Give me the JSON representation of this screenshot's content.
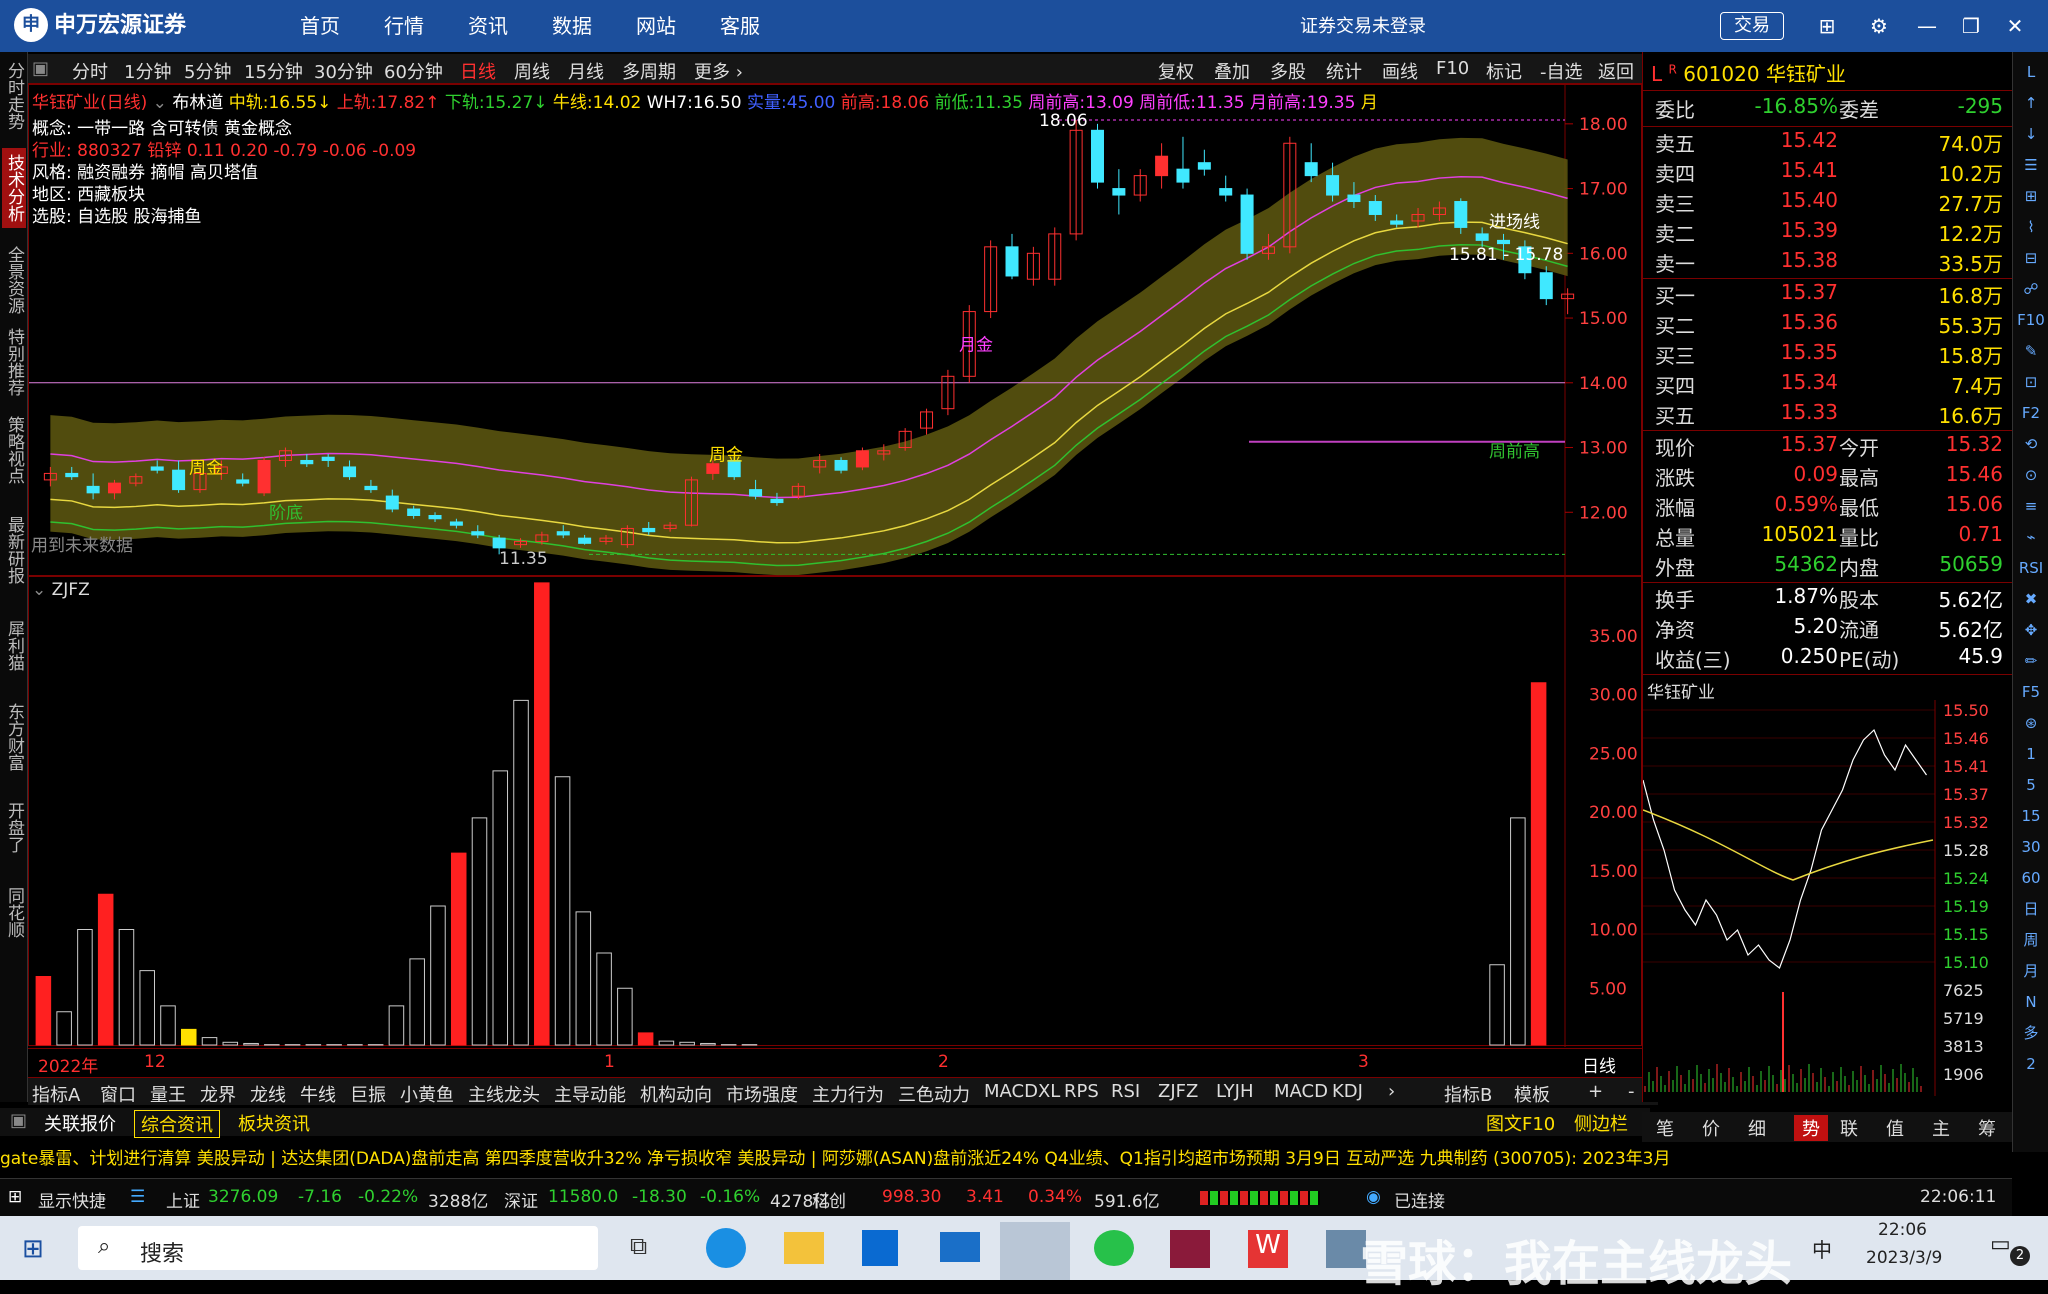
{
  "app": {
    "logo_text": "申万宏源证券",
    "nav": [
      "首页",
      "行情",
      "资讯",
      "数据",
      "网站",
      "客服"
    ],
    "status": "证券交易未登录",
    "trade_button": "交易"
  },
  "left_tabs": [
    "分时走势",
    "技术分析",
    "全景资源",
    "特别推荐",
    "策略视点",
    "最新研报",
    "犀利猫",
    "东方财富",
    "开盘了",
    "同花顺"
  ],
  "right_icons": [
    "L",
    "↑",
    "↓",
    "☰",
    "⊞",
    "⌇",
    "⊟",
    "☍",
    "F10",
    "✎",
    "⊡",
    "F2",
    "⟲",
    "⊙",
    "≡",
    "⌁",
    "RSI",
    "✖",
    "✥",
    "✏",
    "F5",
    "⊛",
    "1",
    "5",
    "15",
    "30",
    "60",
    "日",
    "周",
    "月",
    "N",
    "多",
    "2"
  ],
  "toolbar": {
    "periods": [
      "分时",
      "1分钟",
      "5分钟",
      "15分钟",
      "30分钟",
      "60分钟",
      "日线",
      "周线",
      "月线",
      "多周期",
      "更多"
    ],
    "active_period": "日线",
    "right": [
      "复权",
      "叠加",
      "多股",
      "统计",
      "画线",
      "F10",
      "标记",
      "-自选",
      "返回"
    ]
  },
  "chart_info": {
    "name": "华钰矿业(日线)",
    "indicator": "布林道",
    "mid_label": "中轨:",
    "mid": "16.55",
    "up_label": "上轨:",
    "up": "17.82",
    "down_label": "下轨:",
    "down": "15.27",
    "bull_label": "牛线:",
    "bull": "14.02",
    "wh7_label": "WH7:",
    "wh7": "16.50",
    "vol_label": "实量:",
    "vol": "45.00",
    "prev_high_label": "前高:",
    "prev_high": "18.06",
    "prev_low_label": "前低:",
    "prev_low": "11.35",
    "week_high_label": "周前高:",
    "week_high": "13.09",
    "week_low_label": "周前低:",
    "week_low": "11.35",
    "month_high_label": "月前高:",
    "month_high": "19.35",
    "month_suffix": "月"
  },
  "concepts": {
    "line1": "概念: 一带一路 含可转债 黄金概念",
    "line2": "行业: 880327 铅锌 0.11 0.20 -0.79 -0.06 -0.09",
    "line3": "风格: 融资融券 摘帽 高贝塔值",
    "line4": "地区: 西藏板块",
    "line5": "选股: 自选股 股海捕鱼"
  },
  "annotations": {
    "peak": "18.06",
    "yuejin": "月金",
    "jinchang": "进场线",
    "range": "15.81 - 15.78",
    "zhouqianguo": "周前高",
    "zhoujin1": "周金",
    "zhoujin2": "周金",
    "jiedi": "阶底",
    "low": "11.35",
    "future": "用到未来数据"
  },
  "price_axis": [
    "18.00",
    "17.00",
    "16.00",
    "15.00",
    "14.00",
    "13.00",
    "12.00"
  ],
  "sub_indicator": "ZJFZ",
  "sub_axis": [
    "35.00",
    "30.00",
    "25.00",
    "20.00",
    "15.00",
    "10.00",
    "5.00"
  ],
  "x_labels": {
    "year": "2022年",
    "m12": "12",
    "m1": "1",
    "m2": "2",
    "m3": "3"
  },
  "period_label": "日线",
  "indicator_tabs": [
    "指标A",
    "窗口",
    "量王",
    "龙界",
    "龙线",
    "牛线",
    "巨振",
    "小黄鱼",
    "主线龙头",
    "主导动能",
    "机构动向",
    "市场强度",
    "主力行为",
    "三色动力",
    "MACDXL",
    "RPS",
    "RSI",
    "ZJFZ",
    "LYJH",
    "MACD",
    "KDJ"
  ],
  "indicator_tabs_right": [
    "指标B",
    "模板",
    "+",
    "-"
  ],
  "bottom_tabs": [
    "关联报价",
    "综合资讯",
    "板块资讯"
  ],
  "bottom_right": [
    "图文F10",
    "侧边栏"
  ],
  "ticker": "gate暴雷、计划进行清算    美股异动 | 达达集团(DADA)盘前走高 第四季度营收升32% 净亏损收窄    美股异动 | 阿莎娜(ASAN)盘前涨近24% Q4业绩、Q1指引均超市场预期    3月9日 互动严选    九典制药 (300705): 2023年3月",
  "indexbar": {
    "quick": "显示快捷",
    "sh_label": "上证",
    "sh": "3276.09",
    "sh_chg": "-7.16",
    "sh_pct": "-0.22%",
    "sh_amt": "3288亿",
    "sz_label": "深证",
    "sz": "11580.0",
    "sz_chg": "-18.30",
    "sz_pct": "-0.16%",
    "sz_amt": "4278亿",
    "kc_label": "科创",
    "kc": "998.30",
    "kc_chg": "3.41",
    "kc_pct": "0.34%",
    "kc_amt": "591.6亿",
    "connected": "已连接",
    "time": "22:06:11"
  },
  "quote": {
    "code": "601020",
    "name": "华钰矿业",
    "prefix": "L",
    "weibi_label": "委比",
    "weibi": "-16.85%",
    "weicha_label": "委差",
    "weicha": "-295",
    "asks": [
      {
        "label": "卖五",
        "price": "15.42",
        "vol": "74.0万"
      },
      {
        "label": "卖四",
        "price": "15.41",
        "vol": "10.2万"
      },
      {
        "label": "卖三",
        "price": "15.40",
        "vol": "27.7万"
      },
      {
        "label": "卖二",
        "price": "15.39",
        "vol": "12.2万"
      },
      {
        "label": "卖一",
        "price": "15.38",
        "vol": "33.5万"
      }
    ],
    "bids": [
      {
        "label": "买一",
        "price": "15.37",
        "vol": "16.8万"
      },
      {
        "label": "买二",
        "price": "15.36",
        "vol": "55.3万"
      },
      {
        "label": "买三",
        "price": "15.35",
        "vol": "15.8万"
      },
      {
        "label": "买四",
        "price": "15.34",
        "vol": "7.4万"
      },
      {
        "label": "买五",
        "price": "15.33",
        "vol": "16.6万"
      }
    ],
    "stats": [
      {
        "l1": "现价",
        "v1": "15.37",
        "l2": "今开",
        "v2": "15.32"
      },
      {
        "l1": "涨跌",
        "v1": "0.09",
        "l2": "最高",
        "v2": "15.46"
      },
      {
        "l1": "涨幅",
        "v1": "0.59%",
        "l2": "最低",
        "v2": "15.06"
      },
      {
        "l1": "总量",
        "v1": "105021",
        "l2": "量比",
        "v2": "0.71"
      },
      {
        "l1": "外盘",
        "v1": "54362",
        "l2": "内盘",
        "v2": "50659"
      }
    ],
    "stats2": [
      {
        "l1": "换手",
        "v1": "1.87%",
        "l2": "股本",
        "v2": "5.62亿"
      },
      {
        "l1": "净资",
        "v1": "5.20",
        "l2": "流通",
        "v2": "5.62亿"
      },
      {
        "l1": "收益(三)",
        "v1": "0.250",
        "l2": "PE(动)",
        "v2": "45.9"
      }
    ],
    "mini_title": "华钰矿业",
    "mini_axis": [
      "15.50",
      "15.46",
      "15.41",
      "15.37",
      "15.32",
      "15.28",
      "15.24",
      "15.19",
      "15.15",
      "15.10"
    ],
    "mini_vol_axis": [
      "7625",
      "5719",
      "3813",
      "1906"
    ],
    "tabs": [
      "笔",
      "价",
      "细",
      "势",
      "联",
      "值",
      "主",
      "筹"
    ],
    "active_tab": "势"
  },
  "taskbar": {
    "search": "搜索",
    "time": "22:06",
    "date": "2023/3/9",
    "ime": "中",
    "watermark": "雪球：我在主线龙头",
    "badge": "2"
  },
  "chart_data": [
    {
      "type": "candlestick",
      "title": "华钰矿业(日线)",
      "ylim": [
        11.0,
        18.6
      ],
      "ohlc": [
        [
          12.5,
          12.7,
          12.4,
          12.6
        ],
        [
          12.6,
          12.7,
          12.5,
          12.55
        ],
        [
          12.4,
          12.6,
          12.2,
          12.3
        ],
        [
          12.3,
          12.5,
          12.2,
          12.45
        ],
        [
          12.45,
          12.6,
          12.4,
          12.55
        ],
        [
          12.7,
          12.8,
          12.6,
          12.65
        ],
        [
          12.65,
          12.8,
          12.3,
          12.35
        ],
        [
          12.35,
          12.7,
          12.3,
          12.6
        ],
        [
          12.6,
          12.8,
          12.5,
          12.7
        ],
        [
          12.5,
          12.6,
          12.4,
          12.45
        ],
        [
          12.3,
          12.85,
          12.25,
          12.8
        ],
        [
          12.8,
          13.0,
          12.7,
          12.95
        ],
        [
          12.8,
          12.9,
          12.7,
          12.75
        ],
        [
          12.85,
          12.9,
          12.7,
          12.8
        ],
        [
          12.7,
          12.8,
          12.5,
          12.55
        ],
        [
          12.4,
          12.5,
          12.3,
          12.35
        ],
        [
          12.25,
          12.35,
          12.0,
          12.05
        ],
        [
          12.05,
          12.1,
          11.9,
          11.95
        ],
        [
          11.95,
          12.0,
          11.85,
          11.9
        ],
        [
          11.85,
          11.9,
          11.75,
          11.8
        ],
        [
          11.7,
          11.8,
          11.6,
          11.65
        ],
        [
          11.6,
          11.65,
          11.35,
          11.45
        ],
        [
          11.5,
          11.6,
          11.45,
          11.55
        ],
        [
          11.55,
          11.7,
          11.5,
          11.65
        ],
        [
          11.7,
          11.8,
          11.6,
          11.65
        ],
        [
          11.6,
          11.65,
          11.5,
          11.52
        ],
        [
          11.55,
          11.65,
          11.5,
          11.6
        ],
        [
          11.5,
          11.8,
          11.45,
          11.75
        ],
        [
          11.75,
          11.85,
          11.65,
          11.7
        ],
        [
          11.75,
          11.85,
          11.7,
          11.8
        ],
        [
          11.8,
          12.55,
          11.78,
          12.5
        ],
        [
          12.6,
          12.8,
          12.5,
          12.75
        ],
        [
          12.8,
          12.85,
          12.5,
          12.55
        ],
        [
          12.35,
          12.5,
          12.2,
          12.25
        ],
        [
          12.2,
          12.3,
          12.1,
          12.15
        ],
        [
          12.25,
          12.45,
          12.2,
          12.4
        ],
        [
          12.7,
          12.9,
          12.6,
          12.8
        ],
        [
          12.8,
          12.85,
          12.6,
          12.65
        ],
        [
          12.7,
          13.0,
          12.65,
          12.95
        ],
        [
          12.9,
          13.05,
          12.8,
          12.95
        ],
        [
          13.0,
          13.3,
          12.95,
          13.25
        ],
        [
          13.3,
          13.6,
          13.2,
          13.55
        ],
        [
          13.6,
          14.2,
          13.5,
          14.1
        ],
        [
          14.1,
          15.2,
          14.0,
          15.1
        ],
        [
          15.1,
          16.2,
          15.0,
          16.1
        ],
        [
          16.1,
          16.3,
          15.6,
          15.65
        ],
        [
          15.6,
          16.1,
          15.5,
          16.0
        ],
        [
          15.6,
          16.4,
          15.5,
          16.3
        ],
        [
          16.3,
          18.06,
          16.2,
          17.9
        ],
        [
          17.9,
          18.0,
          17.0,
          17.1
        ],
        [
          17.0,
          17.3,
          16.6,
          16.9
        ],
        [
          16.9,
          17.3,
          16.8,
          17.2
        ],
        [
          17.2,
          17.7,
          17.0,
          17.5
        ],
        [
          17.3,
          17.8,
          17.0,
          17.1
        ],
        [
          17.4,
          17.6,
          17.2,
          17.3
        ],
        [
          17.0,
          17.2,
          16.8,
          16.9
        ],
        [
          16.9,
          17.0,
          15.9,
          16.0
        ],
        [
          16.0,
          16.3,
          15.9,
          16.1
        ],
        [
          16.1,
          17.8,
          16.0,
          17.7
        ],
        [
          17.4,
          17.7,
          17.1,
          17.2
        ],
        [
          17.2,
          17.4,
          16.8,
          16.9
        ],
        [
          16.9,
          17.1,
          16.7,
          16.8
        ],
        [
          16.8,
          16.9,
          16.5,
          16.6
        ],
        [
          16.5,
          16.6,
          16.4,
          16.45
        ],
        [
          16.5,
          16.7,
          16.4,
          16.6
        ],
        [
          16.6,
          16.8,
          16.5,
          16.7
        ],
        [
          16.8,
          16.85,
          16.3,
          16.4
        ],
        [
          16.3,
          16.4,
          16.1,
          16.2
        ],
        [
          16.2,
          16.3,
          15.9,
          16.15
        ],
        [
          16.1,
          16.2,
          15.6,
          15.7
        ],
        [
          15.7,
          15.8,
          15.2,
          15.3
        ],
        [
          15.3,
          15.46,
          15.06,
          15.37
        ]
      ]
    },
    {
      "type": "bar",
      "title": "ZJFZ",
      "ylim": [
        0,
        40
      ],
      "values": [
        6,
        3,
        10,
        13,
        10,
        6.5,
        3.5,
        1.5,
        0.8,
        0.4,
        0.3,
        0.2,
        0.2,
        0.2,
        0.2,
        0.2,
        0.2,
        3.5,
        7.5,
        12,
        16.5,
        19.5,
        23.5,
        29.5,
        39.5,
        23,
        11.5,
        8,
        5,
        1.2,
        0.5,
        0.4,
        0.3,
        0.2,
        0.2,
        0.1,
        0.1,
        0.1,
        0.1,
        0.1,
        0.1,
        0.1,
        0.1,
        0.1,
        0.1,
        0.1,
        0.1,
        0.1,
        0.1,
        0.1,
        0.1,
        0.1,
        0.1,
        0.1,
        0.1,
        0.1,
        0.1,
        0.1,
        0.1,
        0.1,
        0.1,
        0.1,
        0.1,
        0.1,
        0.1,
        0.1,
        0.1,
        0.1,
        0.1,
        0.1,
        7,
        19.5,
        31
      ],
      "colors": [
        "red",
        "white",
        "white",
        "red",
        "white",
        "white",
        "white",
        "yellow",
        "white",
        "white",
        "white",
        "white",
        "white",
        "white",
        "white",
        "white",
        "white",
        "white",
        "white",
        "white",
        "red",
        "white",
        "white",
        "white",
        "red",
        "white",
        "white",
        "white",
        "white",
        "red",
        "white",
        "white",
        "white",
        "white",
        "white",
        "white",
        "white",
        "white",
        "white",
        "white",
        "white",
        "white",
        "white",
        "white",
        "white",
        "white",
        "white",
        "white",
        "white",
        "white",
        "white",
        "white",
        "white",
        "white",
        "white",
        "white",
        "white",
        "white",
        "white",
        "white",
        "white",
        "white",
        "white",
        "white",
        "white",
        "white",
        "white",
        "white",
        "white",
        "white",
        "white",
        "white",
        "red"
      ]
    }
  ]
}
